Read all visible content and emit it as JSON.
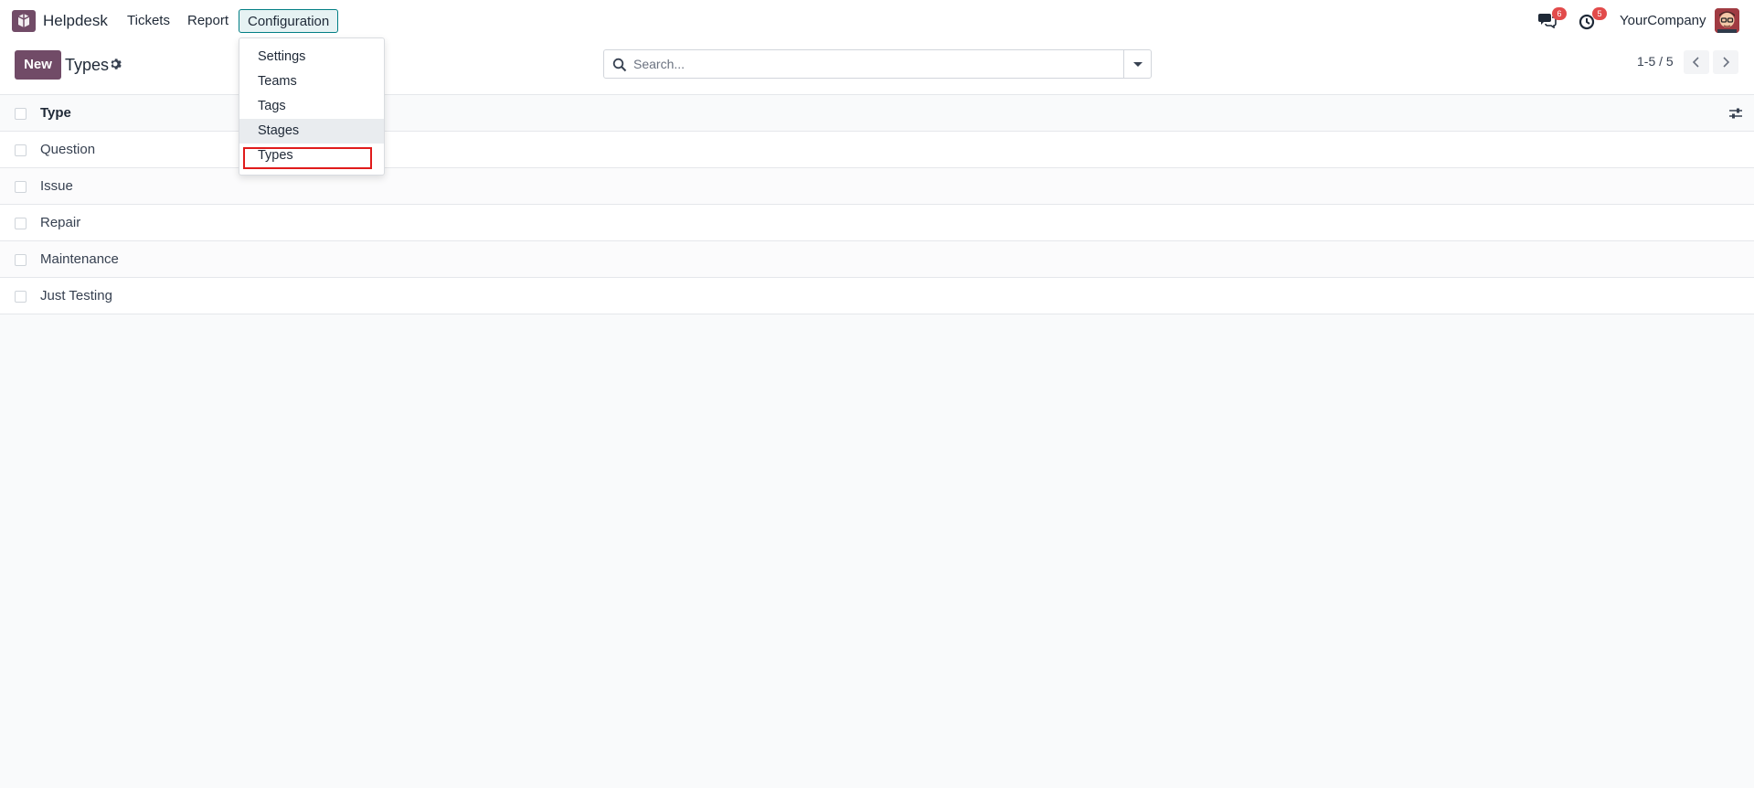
{
  "navbar": {
    "app_name": "Helpdesk",
    "menu": {
      "tickets": "Tickets",
      "report": "Report",
      "configuration": "Configuration"
    },
    "messages_badge": "6",
    "activities_badge": "5",
    "company": "YourCompany"
  },
  "config_menu": {
    "items": [
      "Settings",
      "Teams",
      "Tags",
      "Stages",
      "Types"
    ],
    "hovered": "Stages",
    "highlighted": "Types"
  },
  "control_panel": {
    "new_button": "New",
    "title": "Types",
    "search_placeholder": "Search...",
    "pager": "1-5 / 5"
  },
  "table": {
    "column_header": "Type",
    "rows": [
      "Question",
      "Issue",
      "Repair",
      "Maintenance",
      "Just Testing"
    ]
  },
  "colors": {
    "brand": "#714b67",
    "accent": "#017e84",
    "badge": "#e24b4b",
    "highlight": "#e01b1b"
  }
}
